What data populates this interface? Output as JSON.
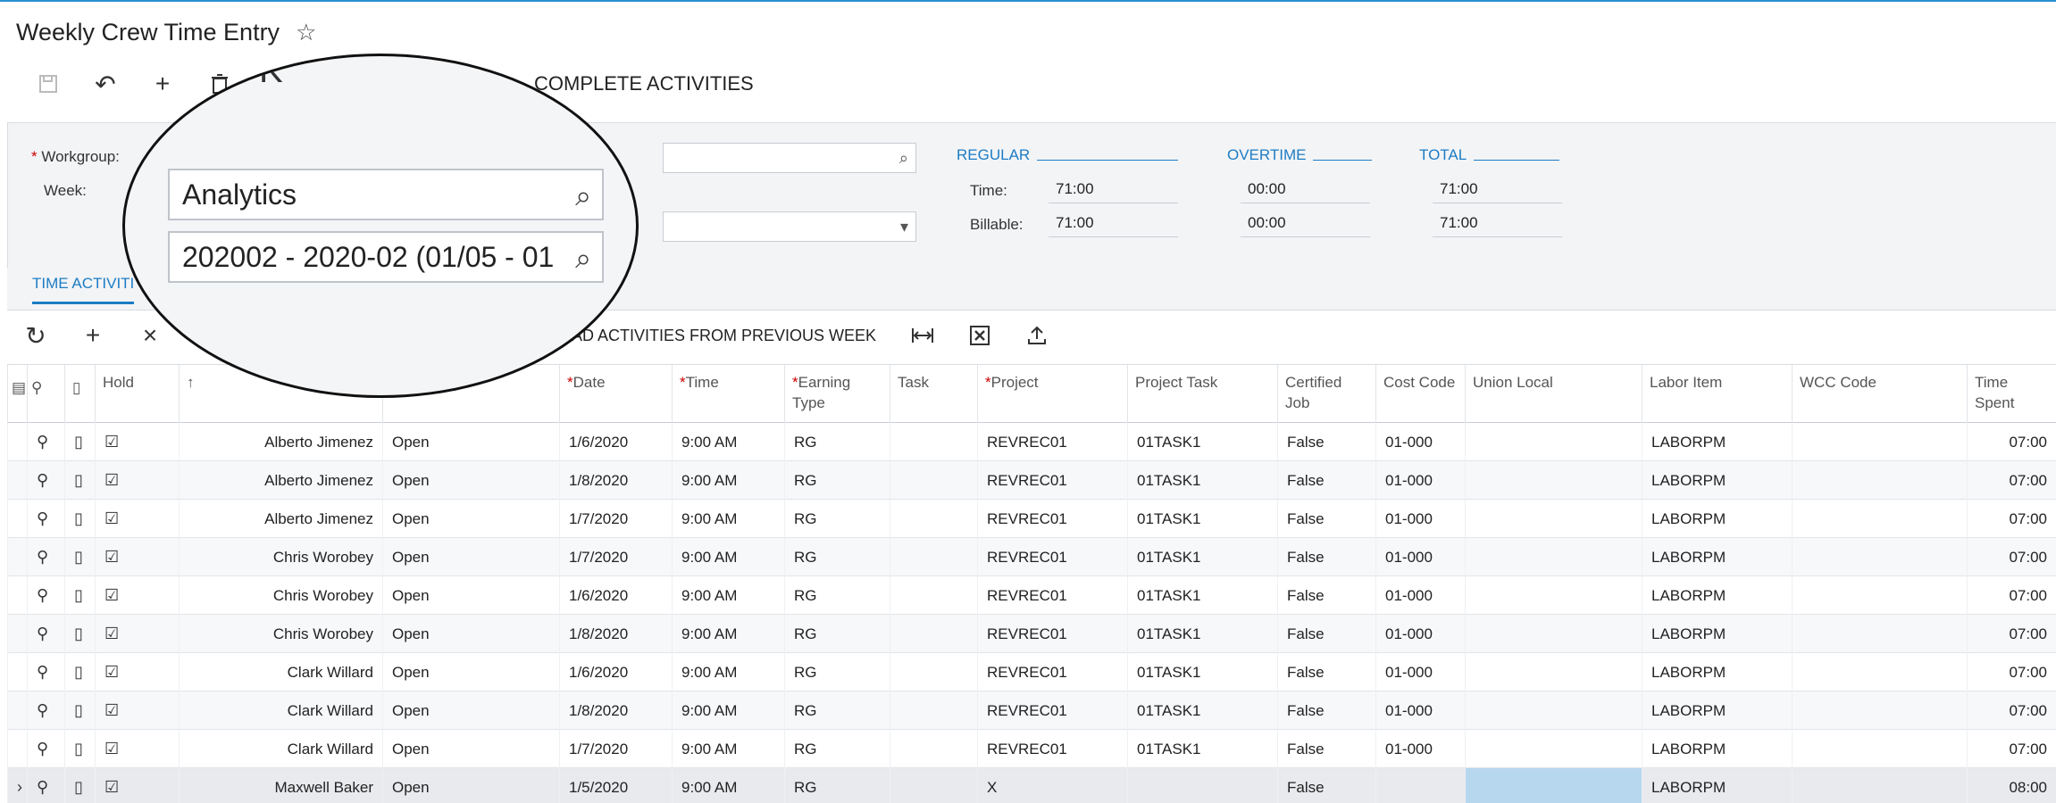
{
  "page": {
    "title": "Weekly Crew Time Entry"
  },
  "toolbar": {
    "complete_activities": "COMPLETE ACTIVITIES",
    "icons": [
      "save-icon",
      "undo-icon",
      "add-icon",
      "delete-icon",
      "copy-icon",
      "first-record-icon"
    ]
  },
  "summary": {
    "workgroup_label": "Workgroup:",
    "week_label": "Week:",
    "workgroup_value": "Analytics",
    "week_value": "202002 - 2020-02 (01/05 - 01",
    "regular_label": "REGULAR",
    "overtime_label": "OVERTIME",
    "total_label": "TOTAL",
    "time_label": "Time:",
    "billable_label": "Billable:",
    "regular_time": "71:00",
    "regular_billable": "71:00",
    "overtime_time": "00:00",
    "overtime_billable": "00:00",
    "total_time": "71:00",
    "total_billable": "71:00"
  },
  "tabs": {
    "active": "TIME ACTIVITI"
  },
  "grid_toolbar": {
    "load_activities": "AD ACTIVITIES FROM PREVIOUS WEEK"
  },
  "grid": {
    "columns": {
      "hold": "Hold",
      "sort": "↑",
      "date": "Date",
      "time": "Time",
      "earning_type": "Earning Type",
      "task": "Task",
      "project": "Project",
      "project_task": "Project Task",
      "certified_job": "Certified Job",
      "cost_code": "Cost Code",
      "union_local": "Union Local",
      "labor_item": "Labor Item",
      "wcc_code": "WCC Code",
      "time_spent": "Time Spent"
    },
    "rows": [
      {
        "employee": "Alberto Jimenez",
        "status": "Open",
        "date": "1/6/2020",
        "time": "9:00 AM",
        "earning": "RG",
        "project": "REVREC01",
        "project_task": "01TASK1",
        "certified": "False",
        "cost_code": "01-000",
        "labor_item": "LABORPM",
        "time_spent": "07:00"
      },
      {
        "employee": "Alberto Jimenez",
        "status": "Open",
        "date": "1/8/2020",
        "time": "9:00 AM",
        "earning": "RG",
        "project": "REVREC01",
        "project_task": "01TASK1",
        "certified": "False",
        "cost_code": "01-000",
        "labor_item": "LABORPM",
        "time_spent": "07:00"
      },
      {
        "employee": "Alberto Jimenez",
        "status": "Open",
        "date": "1/7/2020",
        "time": "9:00 AM",
        "earning": "RG",
        "project": "REVREC01",
        "project_task": "01TASK1",
        "certified": "False",
        "cost_code": "01-000",
        "labor_item": "LABORPM",
        "time_spent": "07:00"
      },
      {
        "employee": "Chris Worobey",
        "status": "Open",
        "date": "1/7/2020",
        "time": "9:00 AM",
        "earning": "RG",
        "project": "REVREC01",
        "project_task": "01TASK1",
        "certified": "False",
        "cost_code": "01-000",
        "labor_item": "LABORPM",
        "time_spent": "07:00"
      },
      {
        "employee": "Chris Worobey",
        "status": "Open",
        "date": "1/6/2020",
        "time": "9:00 AM",
        "earning": "RG",
        "project": "REVREC01",
        "project_task": "01TASK1",
        "certified": "False",
        "cost_code": "01-000",
        "labor_item": "LABORPM",
        "time_spent": "07:00"
      },
      {
        "employee": "Chris Worobey",
        "status": "Open",
        "date": "1/8/2020",
        "time": "9:00 AM",
        "earning": "RG",
        "project": "REVREC01",
        "project_task": "01TASK1",
        "certified": "False",
        "cost_code": "01-000",
        "labor_item": "LABORPM",
        "time_spent": "07:00"
      },
      {
        "employee": "Clark Willard",
        "status": "Open",
        "date": "1/6/2020",
        "time": "9:00 AM",
        "earning": "RG",
        "project": "REVREC01",
        "project_task": "01TASK1",
        "certified": "False",
        "cost_code": "01-000",
        "labor_item": "LABORPM",
        "time_spent": "07:00"
      },
      {
        "employee": "Clark Willard",
        "status": "Open",
        "date": "1/8/2020",
        "time": "9:00 AM",
        "earning": "RG",
        "project": "REVREC01",
        "project_task": "01TASK1",
        "certified": "False",
        "cost_code": "01-000",
        "labor_item": "LABORPM",
        "time_spent": "07:00"
      },
      {
        "employee": "Clark Willard",
        "status": "Open",
        "date": "1/7/2020",
        "time": "9:00 AM",
        "earning": "RG",
        "project": "REVREC01",
        "project_task": "01TASK1",
        "certified": "False",
        "cost_code": "01-000",
        "labor_item": "LABORPM",
        "time_spent": "07:00"
      },
      {
        "employee": "Maxwell Baker",
        "status": "Open",
        "date": "1/5/2020",
        "time": "9:00 AM",
        "earning": "RG",
        "project": "X",
        "project_task": "",
        "certified": "False",
        "cost_code": "",
        "labor_item": "LABORPM",
        "time_spent": "08:00"
      }
    ]
  },
  "colors": {
    "accent": "#1c7cc4",
    "highlight": "#b7d7ef"
  }
}
